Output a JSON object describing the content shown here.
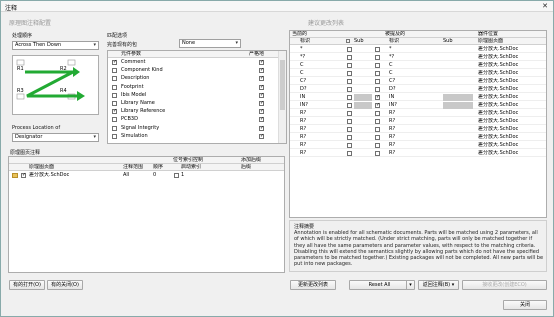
{
  "window": {
    "title": "注释",
    "close_glyph": "✕"
  },
  "left": {
    "group_title": "原理图注释配置",
    "order_label": "处理顺序",
    "order_value": "Across Then Down",
    "diagram_labels": [
      "R1",
      "R2",
      "R3",
      "R4"
    ],
    "location_label": "Process Location of",
    "location_value": "Designator",
    "match_title": "匹配选项",
    "match_label": "完善现有的包",
    "match_value": "None",
    "params_headers": [
      "元件参数",
      "严格地"
    ],
    "params": [
      {
        "name": "Comment",
        "checked": true,
        "strict": true
      },
      {
        "name": "Component Kind",
        "checked": false,
        "strict": true
      },
      {
        "name": "Description",
        "checked": false,
        "strict": true
      },
      {
        "name": "Footprint",
        "checked": false,
        "strict": true
      },
      {
        "name": "Ibis Model",
        "checked": false,
        "strict": true
      },
      {
        "name": "Library Name",
        "checked": false,
        "strict": true
      },
      {
        "name": "Library Reference",
        "checked": true,
        "strict": true
      },
      {
        "name": "PCB3D",
        "checked": false,
        "strict": true
      },
      {
        "name": "Signal Integrity",
        "checked": false,
        "strict": true
      },
      {
        "name": "Simulation",
        "checked": false,
        "strict": true
      }
    ],
    "sheets_title": "原理图页注释",
    "sheets_headers": [
      "原理图页面",
      "注释范围",
      "顺序",
      "启动索引",
      "后缀"
    ],
    "sheets_header_top": [
      "位号索引控制",
      "添加后缀"
    ],
    "sheets": [
      {
        "name": "差分放大.SchDoc",
        "scope": "All",
        "order": "0",
        "start": "1",
        "suffix": ""
      }
    ],
    "btn_all_on": "有的打开(O)",
    "btn_all_off": "有的关闭(O)"
  },
  "right": {
    "group_title": "建议更改列表",
    "col_groups": [
      "当前的",
      "被提及的",
      "器件位置"
    ],
    "headers": [
      "标识",
      "Sub",
      "标识",
      "Sub",
      "原理图页面"
    ],
    "rows": [
      {
        "cur": "*",
        "locked": false,
        "sub": false,
        "prop": "*",
        "sheet": "差分放大.SchDoc",
        "gray": false
      },
      {
        "cur": "*?",
        "locked": false,
        "sub": false,
        "prop": "*?",
        "sheet": "差分放大.SchDoc",
        "gray": false
      },
      {
        "cur": "C",
        "locked": false,
        "sub": false,
        "prop": "C",
        "sheet": "差分放大.SchDoc",
        "gray": false
      },
      {
        "cur": "C",
        "locked": false,
        "sub": false,
        "prop": "C",
        "sheet": "差分放大.SchDoc",
        "gray": false
      },
      {
        "cur": "C?",
        "locked": false,
        "sub": false,
        "prop": "C?",
        "sheet": "差分放大.SchDoc",
        "gray": false
      },
      {
        "cur": "D?",
        "locked": false,
        "sub": false,
        "prop": "D?",
        "sheet": "差分放大.SchDoc",
        "gray": false
      },
      {
        "cur": "IN",
        "locked": false,
        "sub": true,
        "prop": "IN",
        "sheet": "差分放大.SchDoc",
        "gray": true
      },
      {
        "cur": "IN?",
        "locked": false,
        "sub": true,
        "prop": "IN?",
        "sheet": "差分放大.SchDoc",
        "gray": true
      },
      {
        "cur": "R?",
        "locked": false,
        "sub": false,
        "prop": "R?",
        "sheet": "差分放大.SchDoc",
        "gray": false
      },
      {
        "cur": "R?",
        "locked": false,
        "sub": false,
        "prop": "R?",
        "sheet": "差分放大.SchDoc",
        "gray": false
      },
      {
        "cur": "R?",
        "locked": false,
        "sub": false,
        "prop": "R?",
        "sheet": "差分放大.SchDoc",
        "gray": false
      },
      {
        "cur": "R?",
        "locked": false,
        "sub": false,
        "prop": "R?",
        "sheet": "差分放大.SchDoc",
        "gray": false
      },
      {
        "cur": "R?",
        "locked": false,
        "sub": false,
        "prop": "R?",
        "sheet": "差分放大.SchDoc",
        "gray": false
      },
      {
        "cur": "R?",
        "locked": false,
        "sub": false,
        "prop": "R?",
        "sheet": "差分放大.SchDoc",
        "gray": false
      }
    ],
    "summary_title": "注释摘要",
    "summary_text": "Annotation is enabled for all schematic documents. Parts will be matched using 2 parameters, all of which will be strictly matched. (Under strict matching, parts will only be matched together if they all have the same parameters and parameter values, with respect to the matching criteria. Disabling this will extend the semantics slightly by allowing parts which do not have the specified parameters to be matched together.) Existing packages will not be completed. All new parts will be put into new packages.",
    "btn_update": "更新更改列表",
    "btn_reset": "Reset All",
    "btn_back": "返回注释(B)",
    "btn_accept": "接收更改(创建ECO)",
    "btn_close": "关闭"
  },
  "colors": {
    "arrow_green": "#22aa33",
    "gray_cell": "#c8c8c8"
  }
}
